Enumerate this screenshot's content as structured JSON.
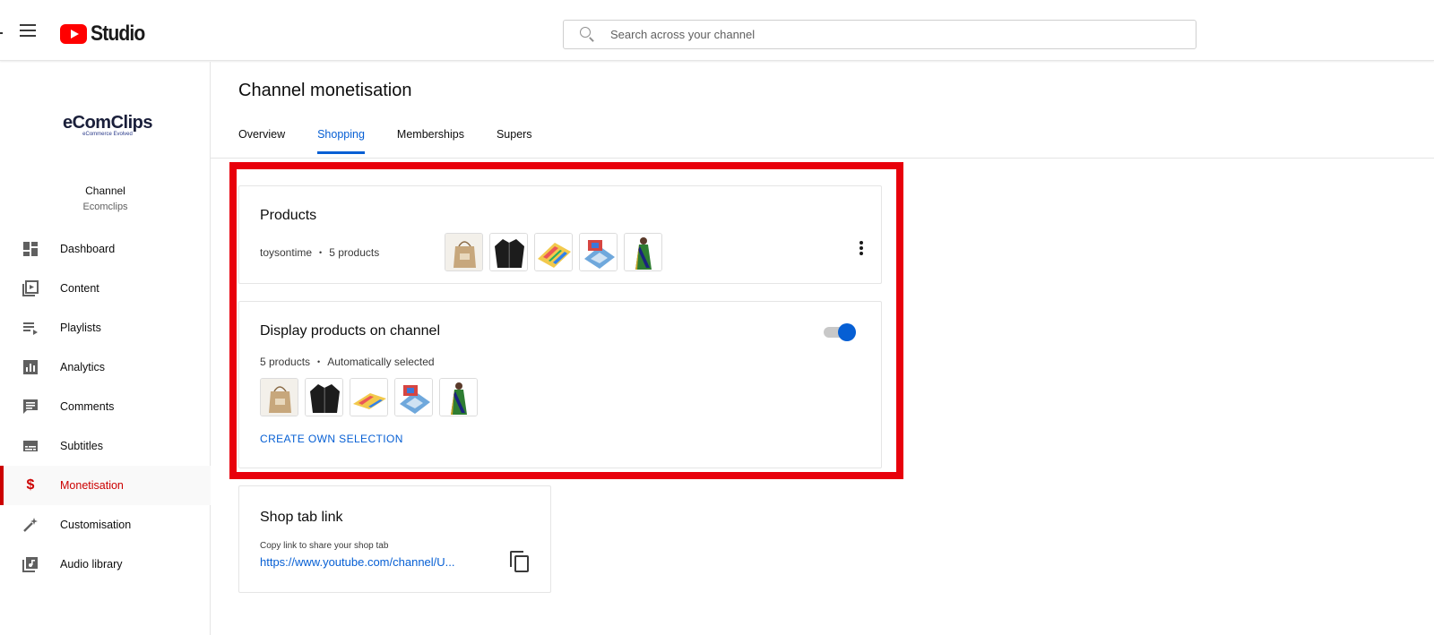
{
  "header": {
    "app_title": "Studio",
    "search_placeholder": "Search across your channel"
  },
  "sidebar": {
    "logo_text": "eComClips",
    "logo_tagline": "eCommerce Evolved",
    "channel_label": "Channel",
    "channel_handle": "Ecomclips",
    "items": [
      {
        "label": "Dashboard",
        "icon": "dashboard-icon"
      },
      {
        "label": "Content",
        "icon": "content-icon"
      },
      {
        "label": "Playlists",
        "icon": "playlists-icon"
      },
      {
        "label": "Analytics",
        "icon": "analytics-icon"
      },
      {
        "label": "Comments",
        "icon": "comments-icon"
      },
      {
        "label": "Subtitles",
        "icon": "subtitles-icon"
      },
      {
        "label": "Monetisation",
        "icon": "dollar-icon",
        "active": true
      },
      {
        "label": "Customisation",
        "icon": "magic-wand-icon"
      },
      {
        "label": "Audio library",
        "icon": "audio-library-icon"
      }
    ]
  },
  "main": {
    "page_title": "Channel monetisation",
    "tabs": [
      {
        "label": "Overview"
      },
      {
        "label": "Shopping",
        "active": true
      },
      {
        "label": "Memberships"
      },
      {
        "label": "Supers"
      }
    ],
    "products_card": {
      "title": "Products",
      "store": "toysontime",
      "count": "5 products"
    },
    "display_card": {
      "title": "Display products on channel",
      "count": "5 products",
      "selection": "Automatically selected",
      "toggle_on": true,
      "create_button": "CREATE OWN SELECTION"
    },
    "shop_card": {
      "title": "Shop tab link",
      "hint": "Copy link to share your shop tab",
      "url": "https://www.youtube.com/channel/U..."
    }
  },
  "colors": {
    "accent_blue": "#065fd4",
    "active_red": "#cc0000",
    "highlight_red": "#e8000b"
  },
  "product_thumbs": [
    "tote-bag",
    "black-jacket",
    "board-game",
    "puzzle-mat",
    "saree"
  ]
}
